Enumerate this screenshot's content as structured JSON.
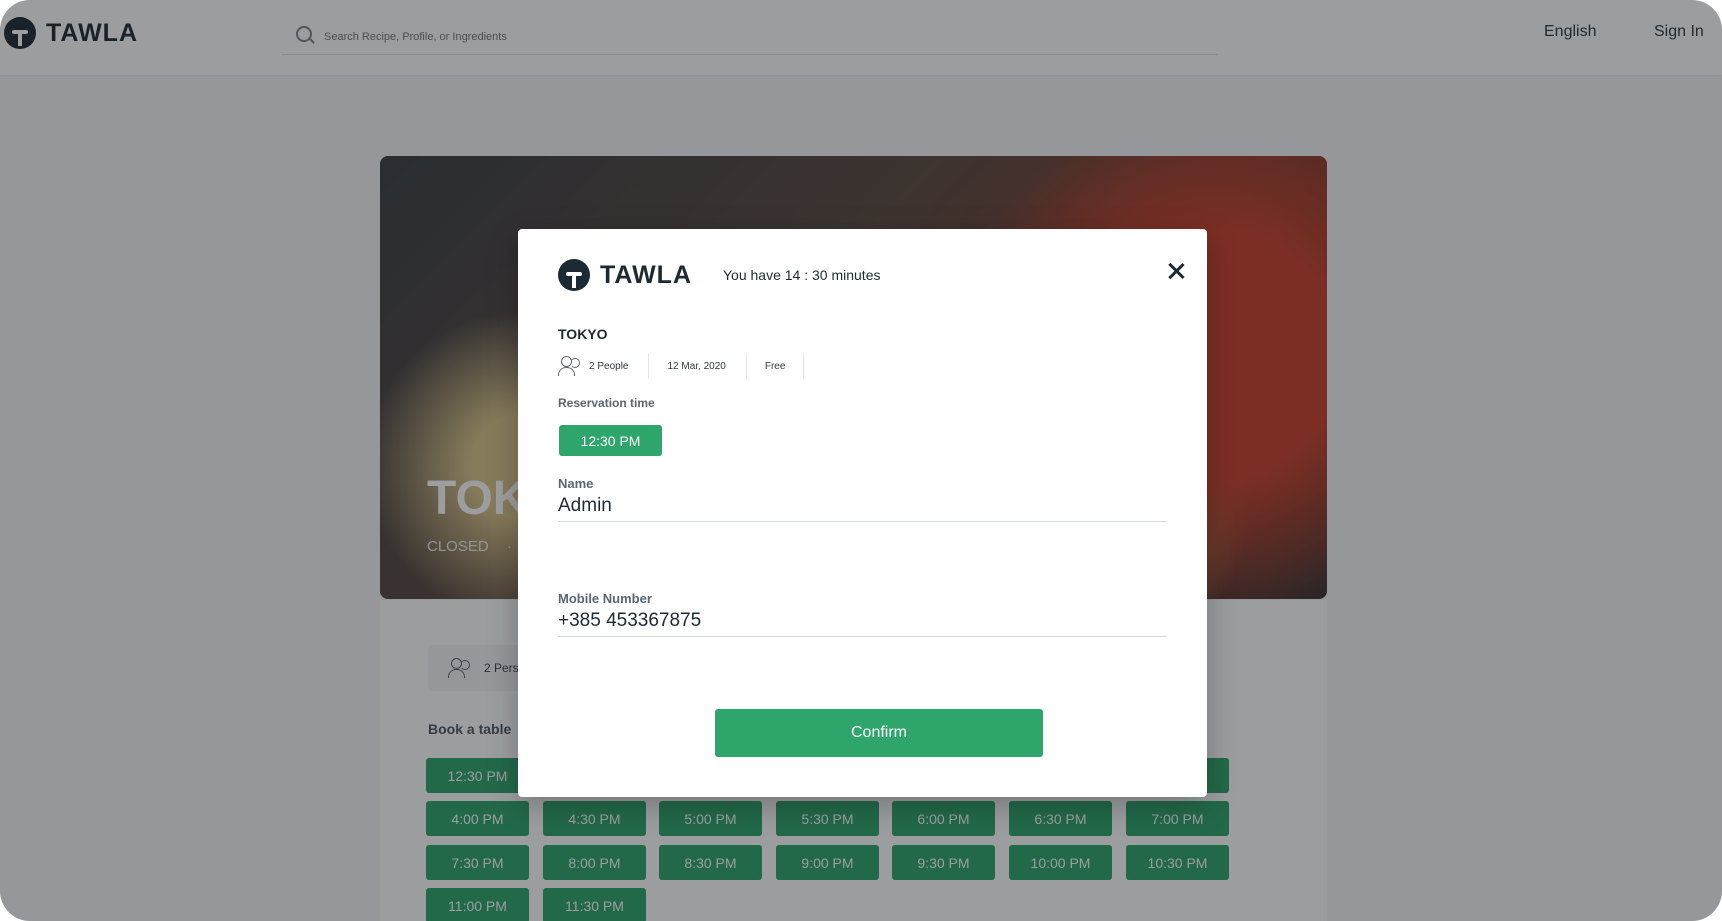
{
  "brand": {
    "name": "TAWLA"
  },
  "header": {
    "search_placeholder": "Search Recipe, Profile, or Ingredients",
    "language": "English",
    "sign_in": "Sign In"
  },
  "restaurant": {
    "title": "TOK",
    "status": "CLOSED",
    "status_separator": "·",
    "people_label": "2 Pers",
    "book_label": "Book a table",
    "time_slots": [
      "12:30 PM",
      "4:00 PM",
      "4:30 PM",
      "5:00 PM",
      "5:30 PM",
      "6:00 PM",
      "6:30 PM",
      "7:00 PM",
      "7:30 PM",
      "8:00 PM",
      "8:30 PM",
      "9:00 PM",
      "9:30 PM",
      "10:00 PM",
      "10:30 PM",
      "11:00 PM",
      "11:30 PM"
    ]
  },
  "modal": {
    "timer_text": "You have 14 : 30 minutes",
    "restaurant_name": "TOKYO",
    "people": "2 People",
    "date": "12 Mar, 2020",
    "price": "Free",
    "reservation_time_label": "Reservation time",
    "reservation_time": "12:30 PM",
    "name_label": "Name",
    "name_value": "Admin",
    "mobile_label": "Mobile Number",
    "mobile_value": "+385 453367875",
    "confirm_label": "Confirm"
  },
  "colors": {
    "accent": "#2ea56b",
    "dark": "#1c2b33",
    "overlay": "rgba(20,22,26,0.42)"
  }
}
